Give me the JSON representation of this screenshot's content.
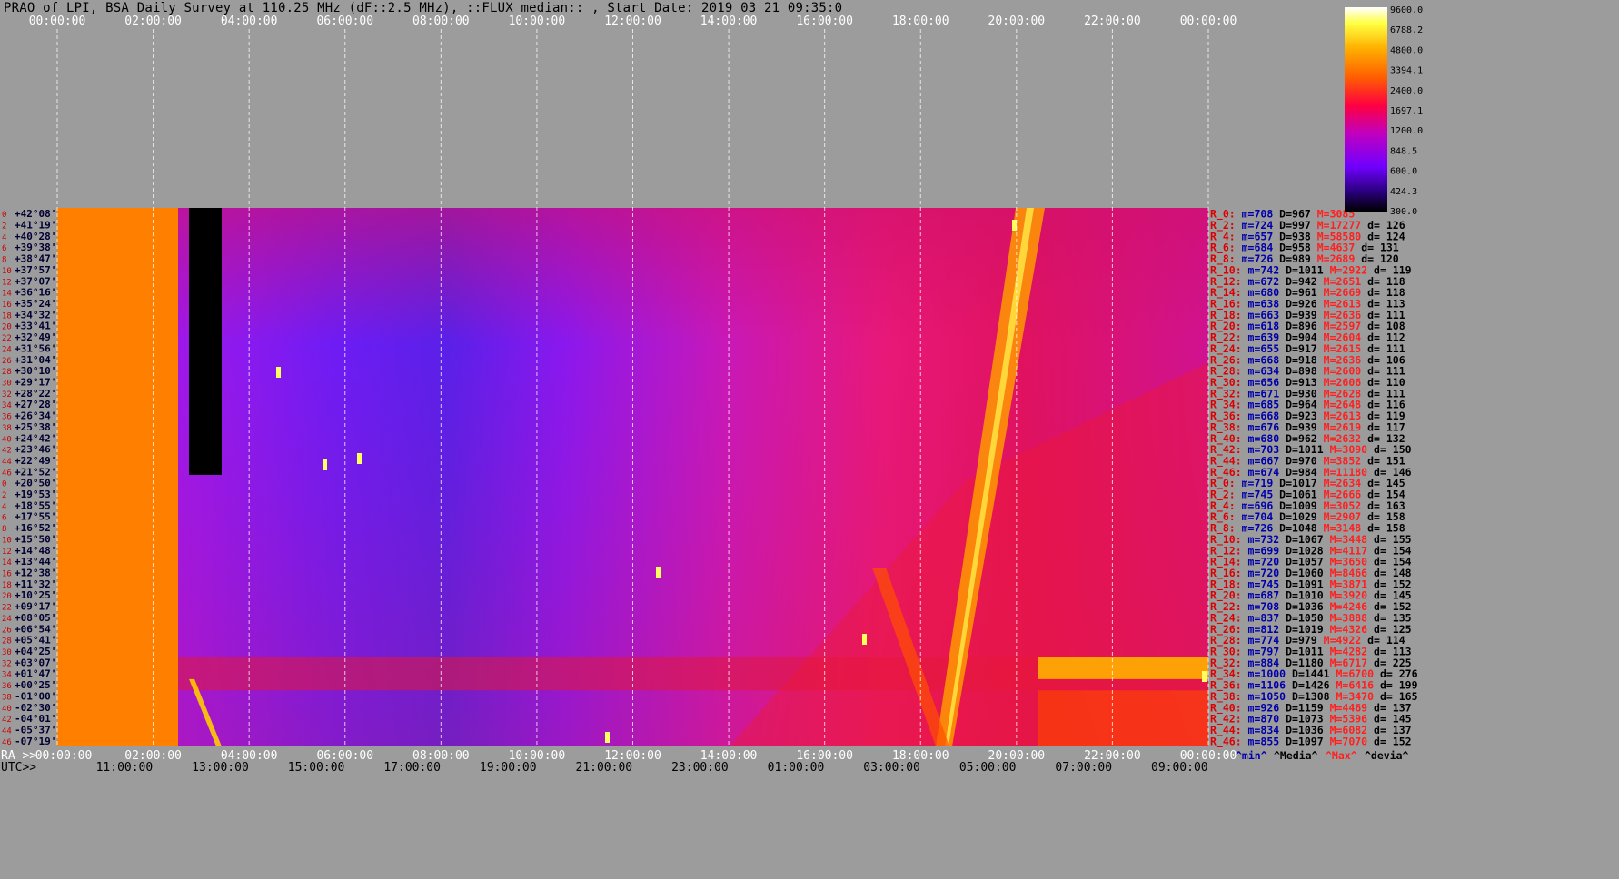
{
  "title": "PRAO of LPI, BSA Daily Survey at 110.25 MHz (dF::2.5 MHz), ::FLUX_median:: , Start Date: 2019 03 21 09:35:0",
  "axis_labels": {
    "ra_prefix": "RA >>",
    "utc_prefix": "UTC>>"
  },
  "colorbar_ticks": [
    "9600.0",
    "6788.2",
    "4800.0",
    "3394.1",
    "2400.0",
    "1697.1",
    "1200.0",
    "848.5",
    "600.0",
    "424.3",
    "300.0"
  ],
  "stats_footer": [
    "^min^",
    "^Media^",
    "^Max^",
    "^devia^"
  ],
  "chart_data": {
    "type": "heatmap",
    "title": "PRAO of LPI, BSA Daily Survey at 110.25 MHz (dF::2.5 MHz), ::FLUX_median:: , Start Date: 2019 03 21 09:35:0",
    "top_ticks": [
      "00:00:00",
      "02:00:00",
      "04:00:00",
      "06:00:00",
      "08:00:00",
      "10:00:00",
      "12:00:00",
      "14:00:00",
      "16:00:00",
      "18:00:00",
      "20:00:00",
      "22:00:00",
      "00:00:00"
    ],
    "ra_ticks": [
      "00:00:00",
      "02:00:00",
      "04:00:00",
      "06:00:00",
      "08:00:00",
      "10:00:00",
      "12:00:00",
      "14:00:00",
      "16:00:00",
      "18:00:00",
      "20:00:00",
      "22:00:00",
      "00:00:00"
    ],
    "utc_ticks": [
      "11:00:00",
      "13:00:00",
      "15:00:00",
      "17:00:00",
      "19:00:00",
      "21:00:00",
      "23:00:00",
      "01:00:00",
      "03:00:00",
      "05:00:00",
      "07:00:00",
      "09:00:00"
    ],
    "declinations": [
      "+42°08'",
      "+41°19'",
      "+40°28'",
      "+39°38'",
      "+38°47'",
      "+37°57'",
      "+37°07'",
      "+36°16'",
      "+35°24'",
      "+34°32'",
      "+33°41'",
      "+32°49'",
      "+31°56'",
      "+31°04'",
      "+30°10'",
      "+29°17'",
      "+28°22'",
      "+27°28'",
      "+26°34'",
      "+25°38'",
      "+24°42'",
      "+23°46'",
      "+22°49'",
      "+21°52'",
      "+20°50'",
      "+19°53'",
      "+18°55'",
      "+17°55'",
      "+16°52'",
      "+15°50'",
      "+14°48'",
      "+13°44'",
      "+12°38'",
      "+11°32'",
      "+10°25'",
      "+09°17'",
      "+08°05'",
      "+06°54'",
      "+05°41'",
      "+04°25'",
      "+03°07'",
      "+01°47'",
      "+00°25'",
      "-01°00'",
      "-02°30'",
      "-04°01'",
      "-05°37'",
      "-07°19'"
    ],
    "row_indices": [
      "0",
      "2",
      "4",
      "6",
      "8",
      "10",
      "12",
      "14",
      "16",
      "18",
      "20",
      "22",
      "24",
      "26",
      "28",
      "30",
      "32",
      "34",
      "36",
      "38",
      "40",
      "42",
      "44",
      "46",
      "0",
      "2",
      "4",
      "6",
      "8",
      "10",
      "12",
      "14",
      "16",
      "18",
      "20",
      "22",
      "24",
      "26",
      "28",
      "30",
      "32",
      "34",
      "36",
      "38",
      "40",
      "42",
      "44",
      "46"
    ],
    "stats": [
      {
        "r": "R_0:",
        "min": "m=708",
        "med": "D=967",
        "max": "M=3085",
        "dev": ""
      },
      {
        "r": "R_2:",
        "min": "m=724",
        "med": "D=997",
        "max": "M=17277",
        "dev": "d= 126"
      },
      {
        "r": "R_4:",
        "min": "m=657",
        "med": "D=938",
        "max": "M=58580",
        "dev": "d= 124"
      },
      {
        "r": "R_6:",
        "min": "m=684",
        "med": "D=958",
        "max": "M=4637",
        "dev": "d= 131"
      },
      {
        "r": "R_8:",
        "min": "m=726",
        "med": "D=989",
        "max": "M=2689",
        "dev": "d= 120"
      },
      {
        "r": "R_10:",
        "min": "m=742",
        "med": "D=1011",
        "max": "M=2922",
        "dev": "d= 119"
      },
      {
        "r": "R_12:",
        "min": "m=672",
        "med": "D=942",
        "max": "M=2651",
        "dev": "d= 118"
      },
      {
        "r": "R_14:",
        "min": "m=680",
        "med": "D=961",
        "max": "M=2669",
        "dev": "d= 118"
      },
      {
        "r": "R_16:",
        "min": "m=638",
        "med": "D=926",
        "max": "M=2613",
        "dev": "d= 113"
      },
      {
        "r": "R_18:",
        "min": "m=663",
        "med": "D=939",
        "max": "M=2636",
        "dev": "d= 111"
      },
      {
        "r": "R_20:",
        "min": "m=618",
        "med": "D=896",
        "max": "M=2597",
        "dev": "d= 108"
      },
      {
        "r": "R_22:",
        "min": "m=639",
        "med": "D=904",
        "max": "M=2604",
        "dev": "d= 112"
      },
      {
        "r": "R_24:",
        "min": "m=655",
        "med": "D=917",
        "max": "M=2615",
        "dev": "d= 111"
      },
      {
        "r": "R_26:",
        "min": "m=668",
        "med": "D=918",
        "max": "M=2636",
        "dev": "d= 106"
      },
      {
        "r": "R_28:",
        "min": "m=634",
        "med": "D=898",
        "max": "M=2600",
        "dev": "d= 111"
      },
      {
        "r": "R_30:",
        "min": "m=656",
        "med": "D=913",
        "max": "M=2606",
        "dev": "d= 110"
      },
      {
        "r": "R_32:",
        "min": "m=671",
        "med": "D=930",
        "max": "M=2628",
        "dev": "d= 111"
      },
      {
        "r": "R_34:",
        "min": "m=685",
        "med": "D=964",
        "max": "M=2648",
        "dev": "d= 116"
      },
      {
        "r": "R_36:",
        "min": "m=668",
        "med": "D=923",
        "max": "M=2613",
        "dev": "d= 119"
      },
      {
        "r": "R_38:",
        "min": "m=676",
        "med": "D=939",
        "max": "M=2619",
        "dev": "d= 117"
      },
      {
        "r": "R_40:",
        "min": "m=680",
        "med": "D=962",
        "max": "M=2632",
        "dev": "d= 132"
      },
      {
        "r": "R_42:",
        "min": "m=703",
        "med": "D=1011",
        "max": "M=3090",
        "dev": "d= 150"
      },
      {
        "r": "R_44:",
        "min": "m=667",
        "med": "D=970",
        "max": "M=3852",
        "dev": "d= 151"
      },
      {
        "r": "R_46:",
        "min": "m=674",
        "med": "D=984",
        "max": "M=11180",
        "dev": "d= 146"
      },
      {
        "r": "R_0:",
        "min": "m=719",
        "med": "D=1017",
        "max": "M=2634",
        "dev": "d= 145"
      },
      {
        "r": "R_2:",
        "min": "m=745",
        "med": "D=1061",
        "max": "M=2666",
        "dev": "d= 154"
      },
      {
        "r": "R_4:",
        "min": "m=696",
        "med": "D=1009",
        "max": "M=3052",
        "dev": "d= 163"
      },
      {
        "r": "R_6:",
        "min": "m=704",
        "med": "D=1029",
        "max": "M=2907",
        "dev": "d= 158"
      },
      {
        "r": "R_8:",
        "min": "m=726",
        "med": "D=1048",
        "max": "M=3148",
        "dev": "d= 158"
      },
      {
        "r": "R_10:",
        "min": "m=732",
        "med": "D=1067",
        "max": "M=3448",
        "dev": "d= 155"
      },
      {
        "r": "R_12:",
        "min": "m=699",
        "med": "D=1028",
        "max": "M=4117",
        "dev": "d= 154"
      },
      {
        "r": "R_14:",
        "min": "m=720",
        "med": "D=1057",
        "max": "M=3650",
        "dev": "d= 154"
      },
      {
        "r": "R_16:",
        "min": "m=720",
        "med": "D=1060",
        "max": "M=8466",
        "dev": "d= 148"
      },
      {
        "r": "R_18:",
        "min": "m=745",
        "med": "D=1091",
        "max": "M=3871",
        "dev": "d= 152"
      },
      {
        "r": "R_20:",
        "min": "m=687",
        "med": "D=1010",
        "max": "M=3920",
        "dev": "d= 145"
      },
      {
        "r": "R_22:",
        "min": "m=708",
        "med": "D=1036",
        "max": "M=4246",
        "dev": "d= 152"
      },
      {
        "r": "R_24:",
        "min": "m=837",
        "med": "D=1050",
        "max": "M=3888",
        "dev": "d= 135"
      },
      {
        "r": "R_26:",
        "min": "m=812",
        "med": "D=1019",
        "max": "M=4326",
        "dev": "d= 125"
      },
      {
        "r": "R_28:",
        "min": "m=774",
        "med": "D=979",
        "max": "M=4922",
        "dev": "d= 114"
      },
      {
        "r": "R_30:",
        "min": "m=797",
        "med": "D=1011",
        "max": "M=4282",
        "dev": "d= 113"
      },
      {
        "r": "R_32:",
        "min": "m=884",
        "med": "D=1180",
        "max": "M=6717",
        "dev": "d= 225"
      },
      {
        "r": "R_34:",
        "min": "m=1000",
        "med": "D=1441",
        "max": "M=6700",
        "dev": "d= 276"
      },
      {
        "r": "R_36:",
        "min": "m=1106",
        "med": "D=1426",
        "max": "M=6416",
        "dev": "d= 199"
      },
      {
        "r": "R_38:",
        "min": "m=1050",
        "med": "D=1308",
        "max": "M=3470",
        "dev": "d= 165"
      },
      {
        "r": "R_40:",
        "min": "m=926",
        "med": "D=1159",
        "max": "M=4469",
        "dev": "d= 137"
      },
      {
        "r": "R_42:",
        "min": "m=870",
        "med": "D=1073",
        "max": "M=5396",
        "dev": "d= 145"
      },
      {
        "r": "R_44:",
        "min": "m=834",
        "med": "D=1036",
        "max": "M=6082",
        "dev": "d= 137"
      },
      {
        "r": "R_46:",
        "min": "m=855",
        "med": "D=1097",
        "max": "M=7070",
        "dev": "d= 152"
      }
    ]
  }
}
